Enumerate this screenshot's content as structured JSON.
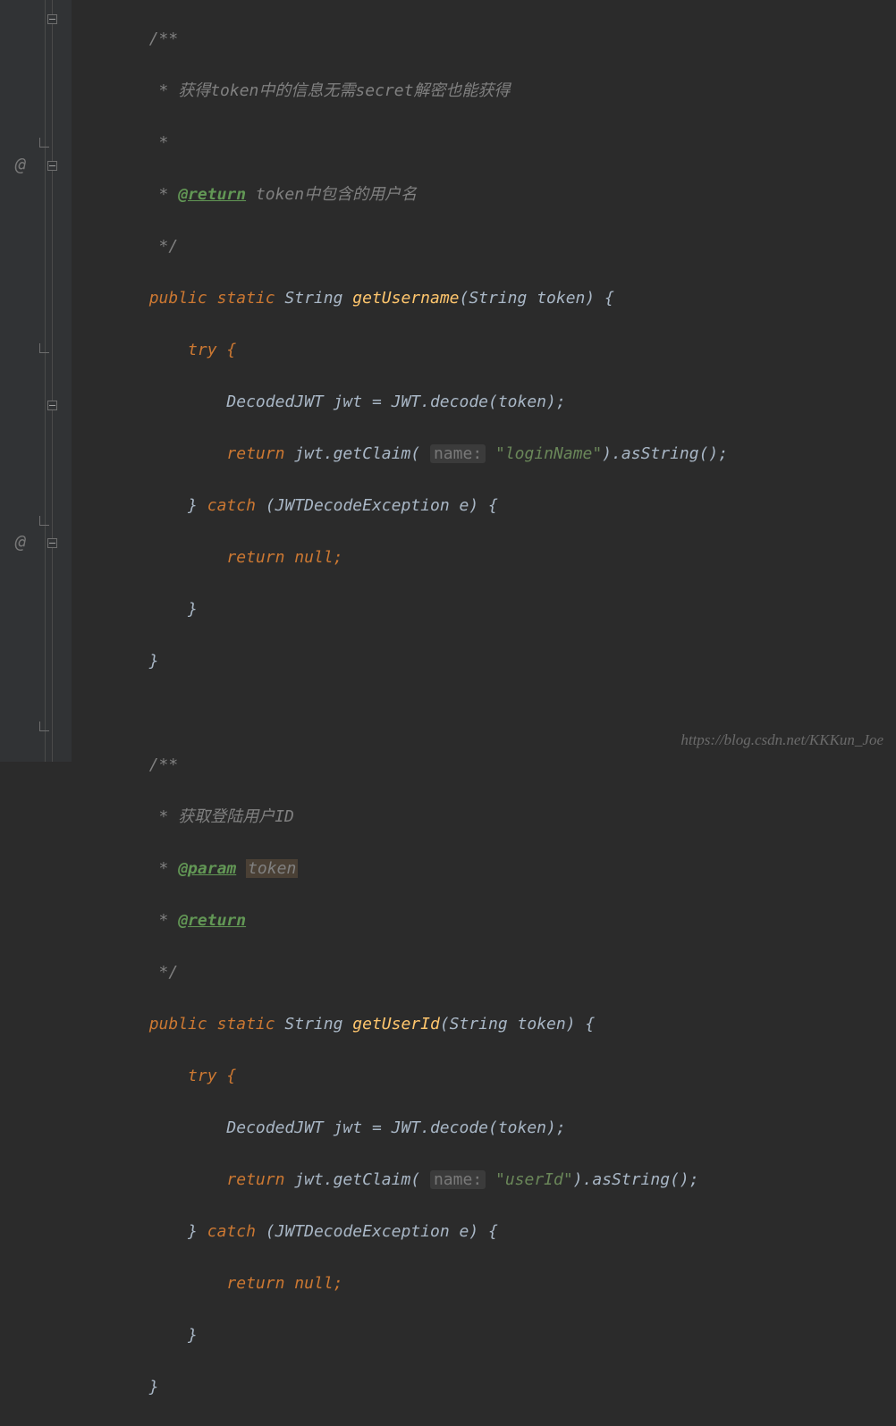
{
  "gutter": {
    "at1": "@",
    "at2": "@"
  },
  "doc1": {
    "open": "/**",
    "l1": " * 获得token中的信息无需secret解密也能获得",
    "l2": " *",
    "l3star": " * ",
    "ret": "@return",
    "retText": " token中包含的用户名",
    "close": " */"
  },
  "m1": {
    "pub": "public ",
    "stat": "static ",
    "type": "String ",
    "name": "getUsername",
    "sig1": "(String token) {",
    "try": "try {",
    "l1a": "DecodedJWT jwt = JWT.",
    "decode": "decode",
    "l1b": "(token);",
    "ret": "return ",
    "l2a": "jwt.getClaim( ",
    "hint": "name:",
    "sp": " ",
    "str": "\"loginName\"",
    "l2b": ").asString();",
    "cbrace": "} ",
    "catch": "catch ",
    "catchsig": "(JWTDecodeException e) {",
    "retnull": "return null;",
    "close1": "}",
    "close2": "}"
  },
  "doc2": {
    "open": "/**",
    "l1": " * 获取登陆用户ID",
    "l2star": " * ",
    "param": "@param",
    "sp": " ",
    "paramName": "token",
    "l3star": " * ",
    "ret": "@return",
    "close": " */"
  },
  "m2": {
    "pub": "public ",
    "stat": "static ",
    "type": "String ",
    "name": "getUserId",
    "sig1": "(String token) {",
    "try": "try {",
    "l1a": "DecodedJWT jwt = JWT.",
    "decode": "decode",
    "l1b": "(token);",
    "ret": "return ",
    "l2a": "jwt.getClaim( ",
    "hint": "name:",
    "sp": " ",
    "str": "\"userId\"",
    "l2b": ").asString();",
    "cbrace": "} ",
    "catch": "catch ",
    "catchsig": "(JWTDecodeException e) {",
    "retnull": "return null;",
    "close1": "}",
    "close2": "}"
  },
  "watermark": "https://blog.csdn.net/KKKun_Joe"
}
